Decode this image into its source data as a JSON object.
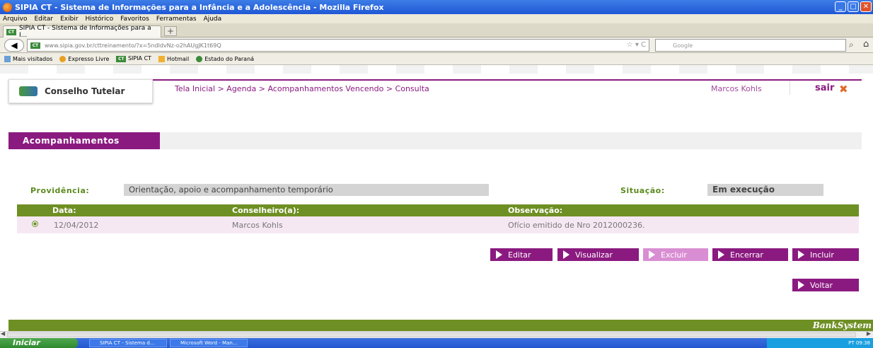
{
  "window": {
    "title": "SIPIA CT - Sistema de Informações para a Infância e a Adolescência - Mozilla Firefox"
  },
  "menu": [
    "Arquivo",
    "Editar",
    "Exibir",
    "Histórico",
    "Favoritos",
    "Ferramentas",
    "Ajuda"
  ],
  "tab": {
    "label": "SIPIA CT - Sistema de Informações para a I..."
  },
  "nav": {
    "url": "www.sipia.gov.br/cttreinamento/?x=5ndldvNz-o2hAUgJK1t69Q",
    "search_placeholder": "Google"
  },
  "bookmarks": [
    "Mais visitados",
    "Expresso Livre",
    "SIPIA CT",
    "Hotmail",
    "Estado do Paraná"
  ],
  "header": {
    "logo_text": "Conselho Tutelar",
    "breadcrumb": "Tela Inicial > Agenda > Acompanhamentos Vencendo > Consulta",
    "user": "Marcos Kohls",
    "logout": "sair"
  },
  "section": {
    "title": "Acompanhamentos"
  },
  "form": {
    "providencia_label": "Providência:",
    "providencia_value": "Orientação, apoio e acompanhamento temporário",
    "situacao_label": "Situação:",
    "situacao_value": "Em execução"
  },
  "table": {
    "columns": [
      "Data:",
      "Conselheiro(a):",
      "Observação:"
    ],
    "rows": [
      {
        "data": "12/04/2012",
        "conselheiro": "Marcos Kohls",
        "observacao": "Ofício emitido de Nro 2012000236."
      }
    ]
  },
  "buttons": {
    "editar": "Editar",
    "visualizar": "Visualizar",
    "excluir": "Excluir",
    "encerrar": "Encerrar",
    "incluir": "Incluir",
    "voltar": "Voltar"
  },
  "footer": {
    "brand": "BankSystem"
  },
  "taskbar": {
    "start": "Iniciar",
    "tasks": [
      "SIPIA CT - Sistema d...",
      "Microsoft Word - Man..."
    ],
    "tray": "PT 09:38"
  },
  "colors": {
    "purple": "#8b1a80",
    "green": "#6e8f23",
    "row_bg": "#f6e8f3"
  }
}
